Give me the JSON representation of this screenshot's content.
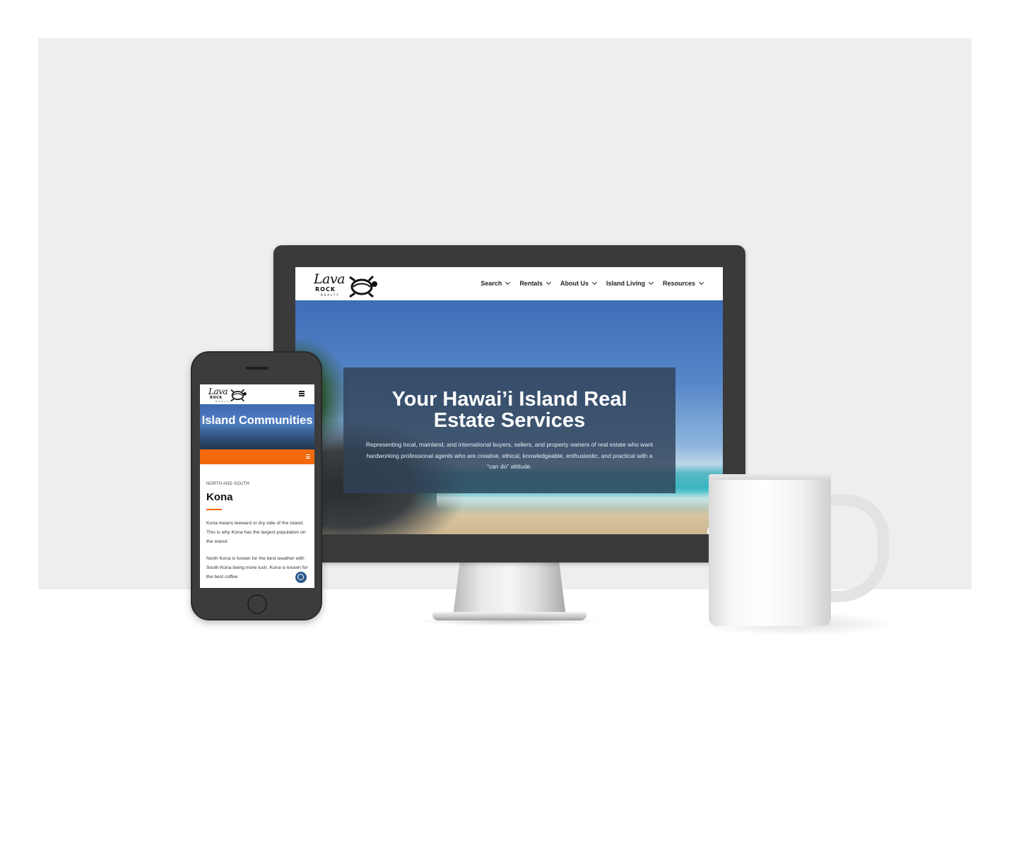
{
  "desktop": {
    "logo": {
      "line1": "Lava",
      "line2": "ROCK",
      "line3": "REALTY",
      "icon": "turtle-icon"
    },
    "nav": [
      {
        "label": "Search",
        "icon": "chevron-down-icon"
      },
      {
        "label": "Rentals",
        "icon": "chevron-down-icon"
      },
      {
        "label": "About Us",
        "icon": "chevron-down-icon"
      },
      {
        "label": "Island Living",
        "icon": "chevron-down-icon"
      },
      {
        "label": "Resources",
        "icon": "chevron-down-icon"
      }
    ],
    "hero": {
      "title": "Your Hawai’i Island Real Estate Services",
      "text": "Representing local, mainland, and international buyers, sellers, and property owners of real estate who want hardworking professional agents who are creative, ethical, knowledgeable, enthusiastic, and practical with a “can do” attitude."
    },
    "accessibility_icon": "accessibility-icon"
  },
  "mobile": {
    "logo": {
      "line1": "Lava",
      "line2": "ROCK",
      "line3": "REALTY",
      "icon": "turtle-icon"
    },
    "menu_icon": "hamburger-icon",
    "banner_title": "Island Communities",
    "submenu_icon": "hamburger-icon",
    "eyebrow": "NORTH AND SOUTH",
    "title": "Kona",
    "paragraph1": "Kona means leeward or dry side of the island.  This is why Kona has the largest population on the island.",
    "paragraph2": "North Kona is known for the best weather with South Kona being more lush.  Kona is known for the best coffee",
    "accessibility_icon": "accessibility-icon"
  },
  "colors": {
    "accent_orange": "#f26a0c",
    "hero_overlay": "#2f4258",
    "accessibility_blue": "#2c5a8c"
  }
}
